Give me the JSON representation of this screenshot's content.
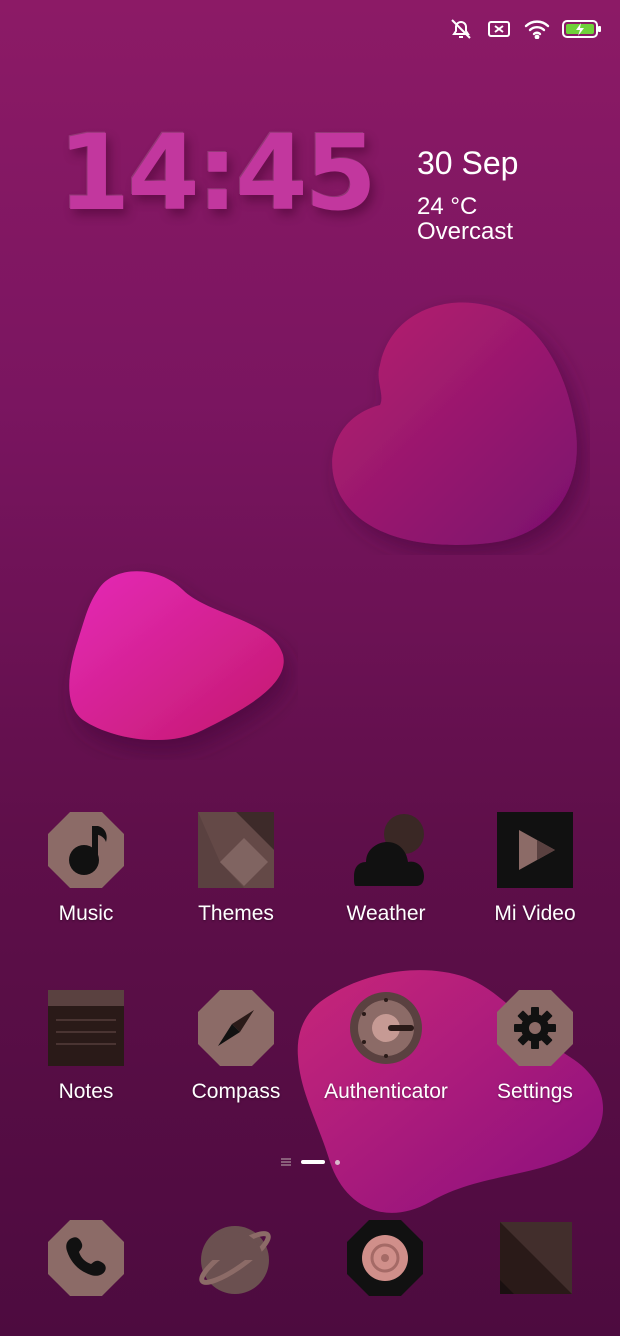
{
  "status_bar": {
    "icons": [
      "alarm-off-icon",
      "sim-disabled-icon",
      "wifi-icon",
      "battery-charging-icon"
    ],
    "battery_color": "#6fd23a"
  },
  "clock": {
    "time": "14:45"
  },
  "weather": {
    "date": "30 Sep",
    "temperature": "24 °C",
    "condition": "Overcast"
  },
  "apps": [
    {
      "label": "Music",
      "icon": "music-note-icon"
    },
    {
      "label": "Themes",
      "icon": "themes-icon"
    },
    {
      "label": "Weather",
      "icon": "cloud-icon"
    },
    {
      "label": "Mi Video",
      "icon": "play-icon"
    },
    {
      "label": "Notes",
      "icon": "notes-icon"
    },
    {
      "label": "Compass",
      "icon": "compass-icon"
    },
    {
      "label": "Authenticator",
      "icon": "google-authenticator-icon"
    },
    {
      "label": "Settings",
      "icon": "gear-icon"
    }
  ],
  "dock": [
    {
      "icon": "phone-icon"
    },
    {
      "icon": "browser-planet-icon"
    },
    {
      "icon": "camera-icon"
    },
    {
      "icon": "messages-icon"
    }
  ],
  "pager": {
    "pages": 2,
    "current": 1
  },
  "colors": {
    "icon_base": "#8c6b67",
    "icon_dark": "#2a1a18",
    "blob_magenta": "#d0238f",
    "blob_purple": "#6e0b63"
  }
}
